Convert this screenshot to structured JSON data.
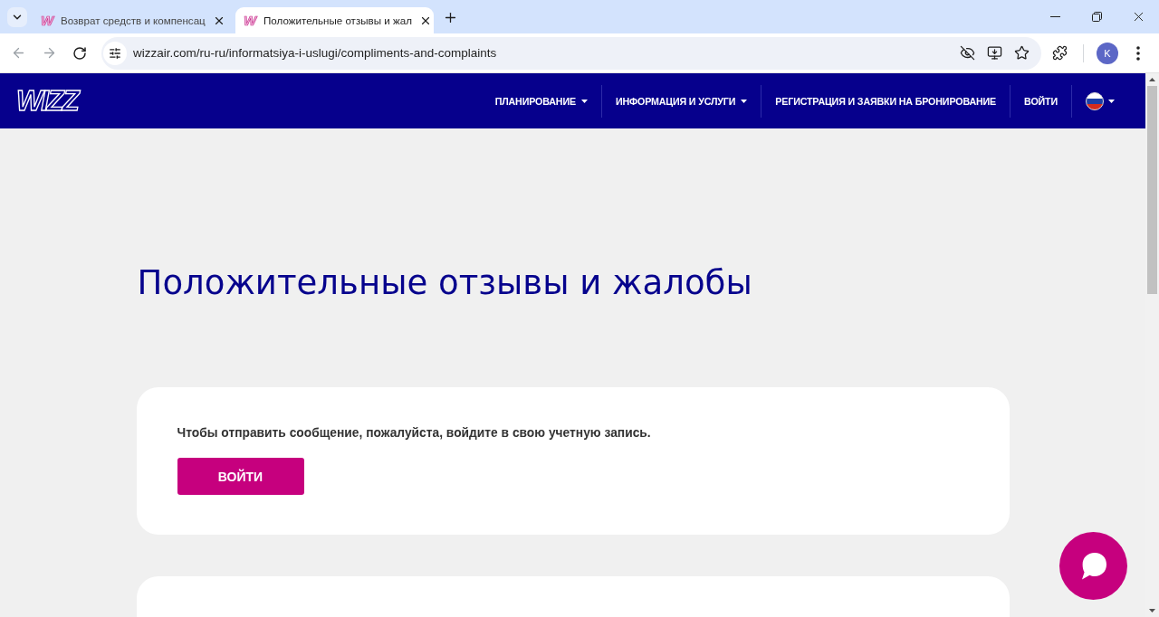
{
  "browser": {
    "tabs": [
      {
        "favicon": "W",
        "title": "Возврат средств и компенсац",
        "selected": false
      },
      {
        "favicon": "W",
        "title": "Положительные отзывы и жал",
        "selected": true
      }
    ],
    "address_bar": {
      "url": "wizzair.com/ru-ru/informatsiya-i-uslugi/compliments-and-complaints"
    },
    "profile": {
      "initial": "K"
    }
  },
  "site_header": {
    "logo": "WIZZ",
    "nav": [
      {
        "label": "ПЛАНИРОВАНИЕ",
        "dropdown": true
      },
      {
        "label": "ИНФОРМАЦИЯ И УСЛУГИ",
        "dropdown": true
      },
      {
        "label": "РЕГИСТРАЦИЯ И ЗАЯВКИ НА БРОНИРОВАНИЕ",
        "dropdown": false
      },
      {
        "label": "ВОЙТИ",
        "dropdown": false
      }
    ]
  },
  "page": {
    "title": "Положительные отзывы и жалобы",
    "login_card": {
      "message": "Чтобы отправить сообщение, пожалуйста, войдите в свою учетную запись.",
      "button": "ВОЙТИ"
    }
  }
}
